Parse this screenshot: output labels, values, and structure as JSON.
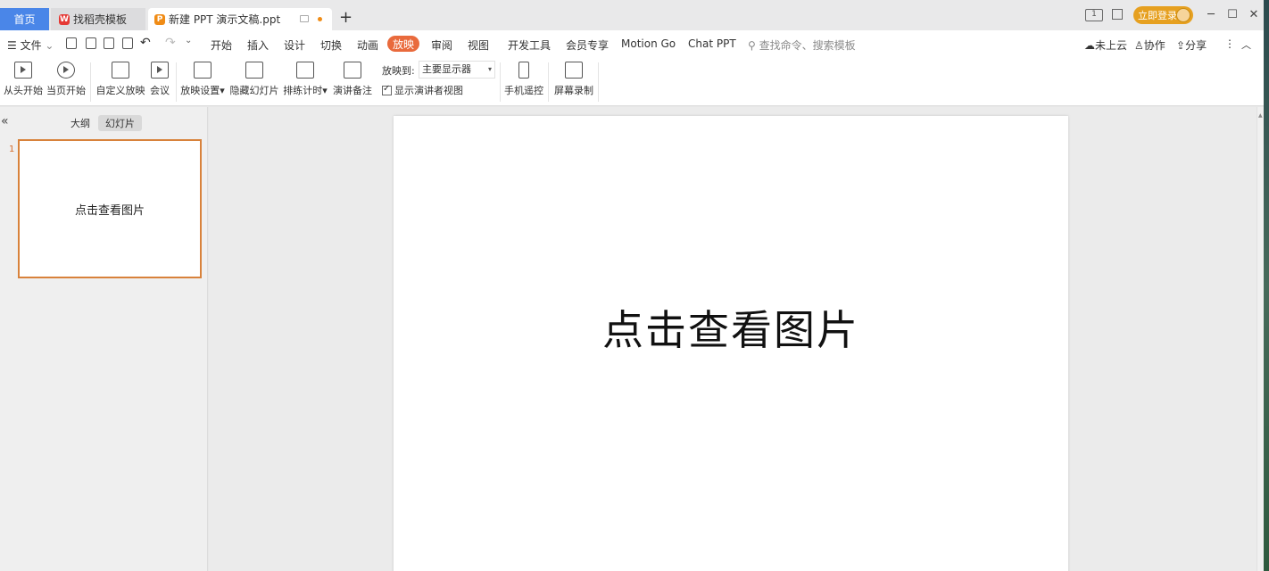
{
  "tabs": {
    "home": "首页",
    "template": "找稻壳模板",
    "document": "新建 PPT 演示文稿.ppt",
    "add": "+"
  },
  "titlebar": {
    "login": "立即登录",
    "layout_badge": "1"
  },
  "menu": {
    "file": "文件",
    "items": [
      "开始",
      "插入",
      "设计",
      "切换",
      "动画",
      "放映",
      "审阅",
      "视图",
      "开发工具",
      "会员专享",
      "Motion Go",
      "Chat PPT"
    ],
    "search_placeholder": "查找命令、搜索模板",
    "cloud": "未上云",
    "collab": "协作",
    "share": "分享"
  },
  "ribbon": {
    "from_start": "从头开始",
    "from_current": "当页开始",
    "custom_show": "自定义放映",
    "meeting": "会议",
    "show_settings": "放映设置",
    "hide_slide": "隐藏幻灯片",
    "rehearse_timing": "排练计时",
    "speaker_notes": "演讲备注",
    "play_to_label": "放映到:",
    "play_to_value": "主要显示器",
    "presenter_view": "显示演讲者视图",
    "phone_remote": "手机遥控",
    "screen_record": "屏幕录制"
  },
  "panel": {
    "outline_tab": "大纲",
    "slides_tab": "幻灯片",
    "slide_number": "1",
    "thumb_text": "点击查看图片"
  },
  "slide": {
    "text": "点击查看图片"
  },
  "colors": {
    "accent": "#e96a3c",
    "home_tab": "#4a86e8",
    "login": "#e6a020"
  }
}
